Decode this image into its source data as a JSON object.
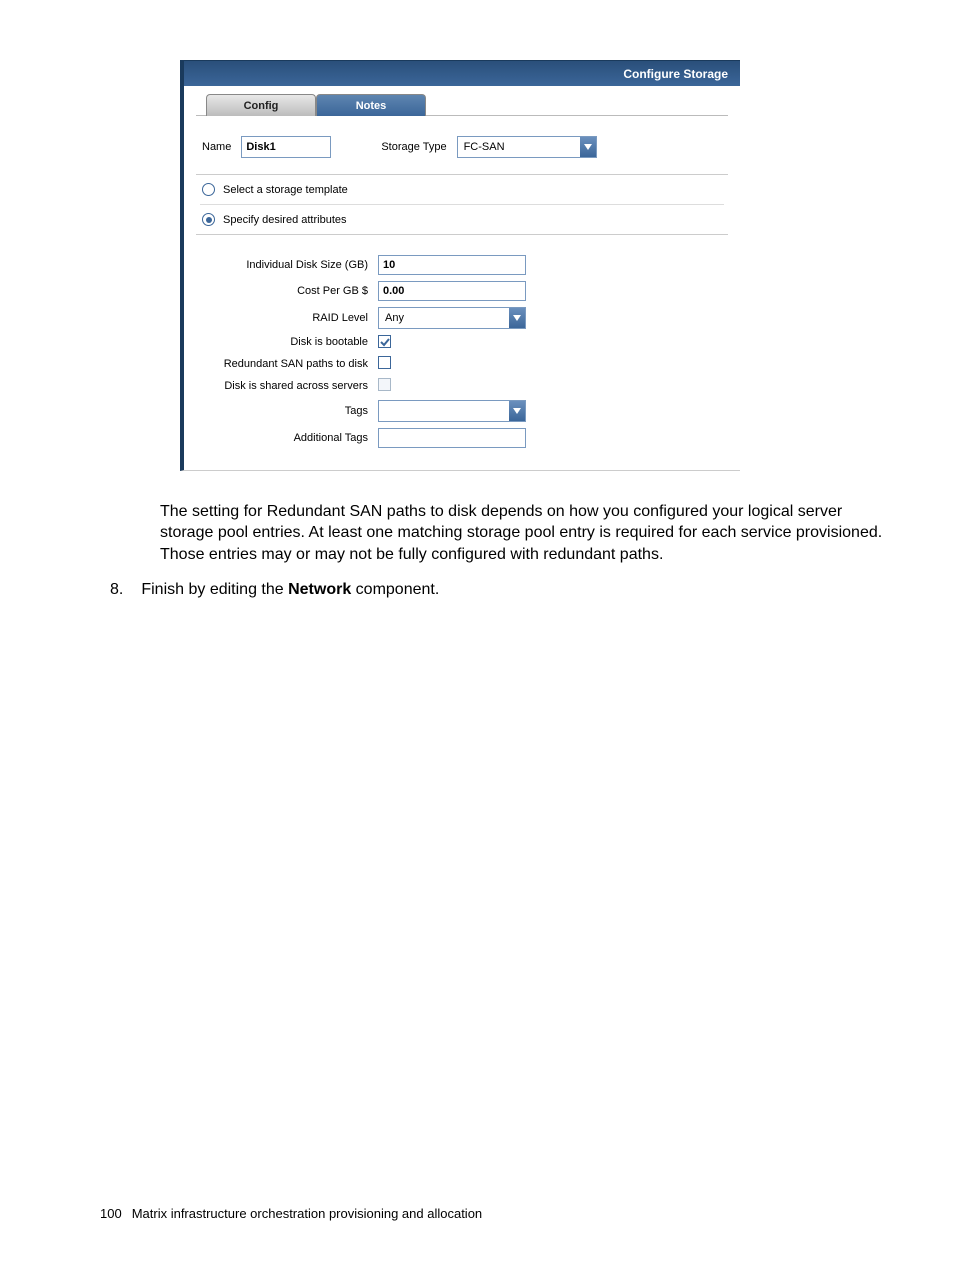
{
  "dialog": {
    "title": "Configure Storage",
    "tabs": {
      "active": "Config",
      "inactive": "Notes"
    },
    "name_label": "Name",
    "name_value": "Disk1",
    "storage_type_label": "Storage Type",
    "storage_type_value": "FC-SAN",
    "radios": {
      "template": "Select a storage template",
      "attributes": "Specify desired attributes"
    },
    "attrs": {
      "disk_size": {
        "label": "Individual Disk Size (GB)",
        "value": "10"
      },
      "cost": {
        "label": "Cost Per GB $",
        "value": "0.00"
      },
      "raid": {
        "label": "RAID Level",
        "value": "Any"
      },
      "bootable": {
        "label": "Disk is bootable",
        "checked": true
      },
      "redundant": {
        "label": "Redundant SAN paths to disk",
        "checked": false
      },
      "shared": {
        "label": "Disk is shared across servers",
        "checked": false,
        "disabled": true
      },
      "tags": {
        "label": "Tags",
        "value": ""
      },
      "addl_tags": {
        "label": "Additional Tags",
        "value": ""
      }
    }
  },
  "doc": {
    "paragraph": "The setting for Redundant SAN paths to disk depends on how you configured your logical server storage pool entries. At least one matching storage pool entry is required for each service provisioned. Those entries may or may not be fully configured with redundant paths.",
    "list_num": "8.",
    "list_item_prefix": "Finish by editing the ",
    "list_item_bold": "Network",
    "list_item_suffix": " component."
  },
  "footer": {
    "page_number": "100",
    "chapter": "Matrix infrastructure orchestration provisioning and allocation"
  }
}
